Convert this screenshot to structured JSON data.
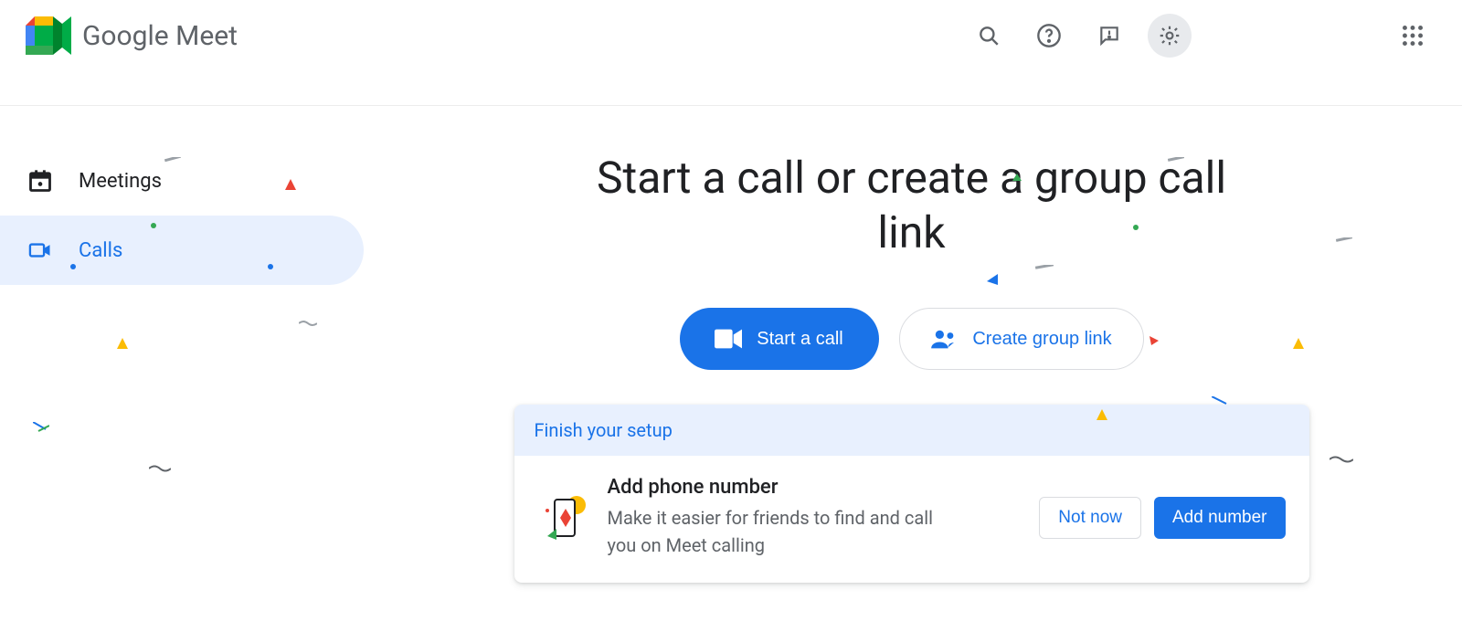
{
  "header": {
    "product_name_1": "Google",
    "product_name_2": "Meet"
  },
  "sidebar": {
    "items": [
      {
        "label": "Meetings"
      },
      {
        "label": "Calls"
      }
    ]
  },
  "main": {
    "title": "Start a call or create a group call link",
    "start_call_label": "Start a call",
    "create_group_label": "Create group link"
  },
  "setup": {
    "heading": "Finish your setup",
    "title": "Add phone number",
    "subtitle": "Make it easier for friends to find and call you on Meet calling",
    "not_now_label": "Not now",
    "add_number_label": "Add number"
  }
}
